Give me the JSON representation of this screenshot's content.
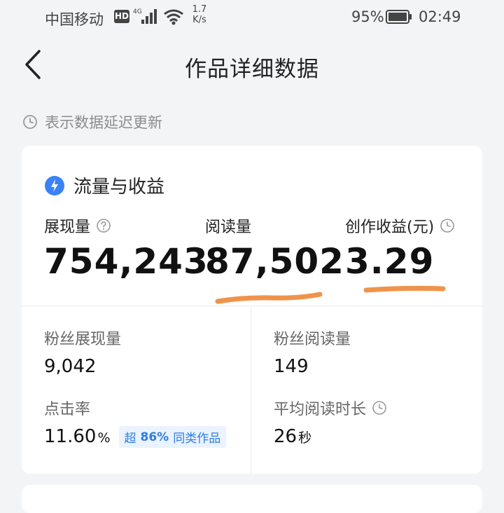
{
  "statusbar": {
    "carrier": "中国移动",
    "hd": "HD",
    "network": "4G",
    "speed_value": "1.7",
    "speed_unit": "K/s",
    "battery": "95%",
    "time": "02:49"
  },
  "nav": {
    "title": "作品详细数据"
  },
  "hint": {
    "text": "表示数据延迟更新"
  },
  "card": {
    "title": "流量与收益",
    "metrics": [
      {
        "label": "展现量",
        "value": "754,243"
      },
      {
        "label": "阅读量",
        "value": "87,502"
      },
      {
        "label": "创作收益(元)",
        "value": "3.29"
      }
    ],
    "sub": [
      {
        "label": "粉丝展现量",
        "value": "9,042"
      },
      {
        "label": "粉丝阅读量",
        "value": "149"
      },
      {
        "label": "点击率",
        "value": "11.60",
        "unit": "%",
        "badge_prefix": "超",
        "badge_value": "86%",
        "badge_suffix": "同类作品"
      },
      {
        "label": "平均阅读时长",
        "value": "26",
        "unit": "秒"
      }
    ]
  },
  "colors": {
    "accent": "#2f7de1",
    "underline": "#f0934a",
    "background": "#f3f4f6"
  }
}
